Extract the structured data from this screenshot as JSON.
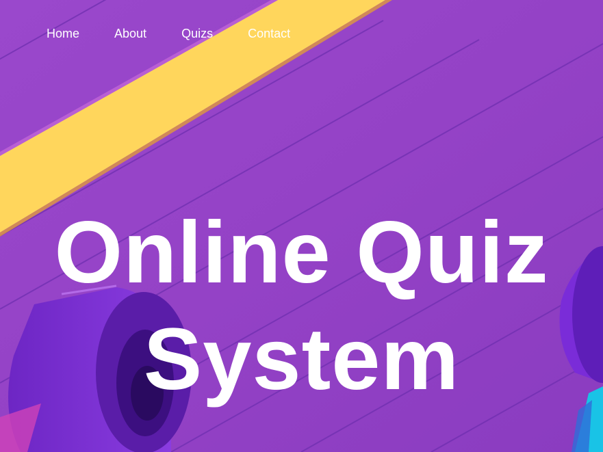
{
  "nav": {
    "items": [
      {
        "label": "Home"
      },
      {
        "label": "About"
      },
      {
        "label": "Quizs"
      },
      {
        "label": "Contact"
      }
    ]
  },
  "hero": {
    "title_line1": "Online Quiz",
    "title_line2": "System"
  },
  "colors": {
    "background": "#9542c8",
    "stripe": "#ffd65c",
    "accent_cyan": "#19c3e6",
    "text": "#ffffff"
  }
}
